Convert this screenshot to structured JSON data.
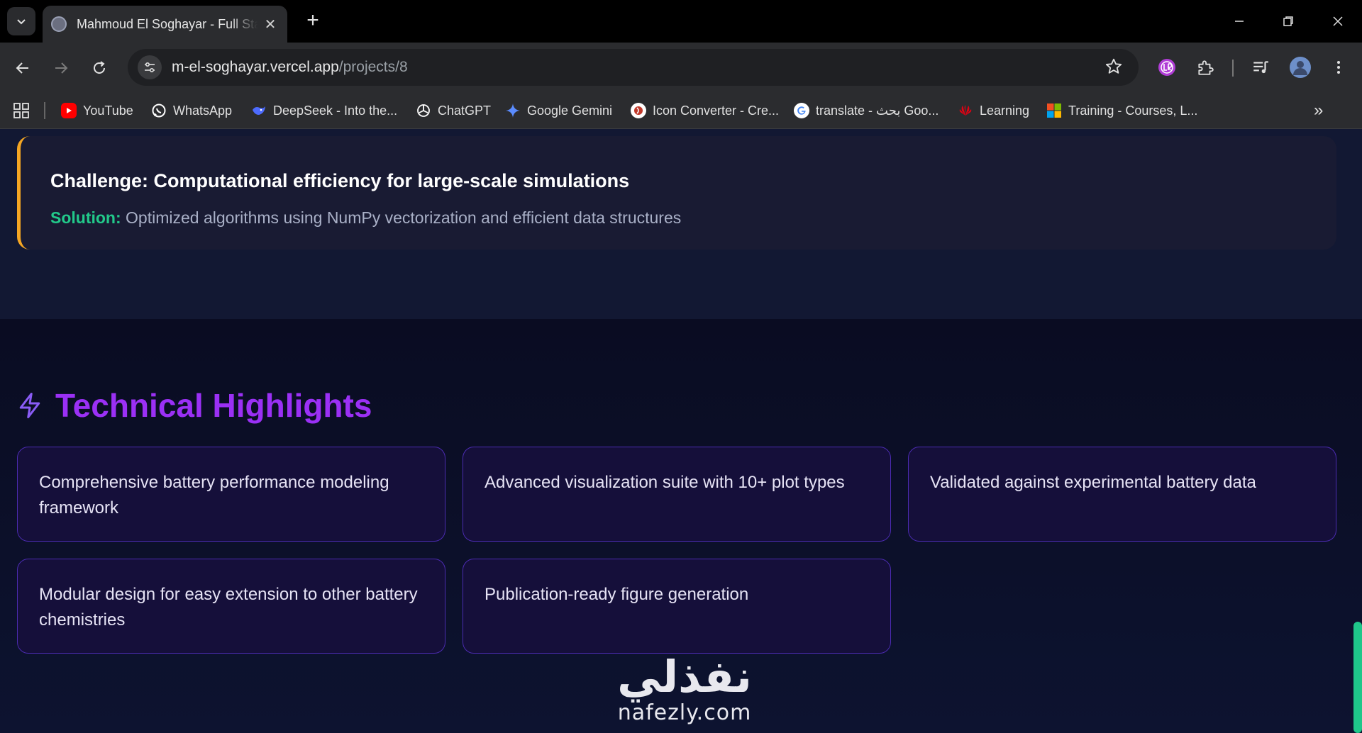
{
  "browser": {
    "tab_title": "Mahmoud El Soghayar - Full Stack Developer",
    "tab_close": "✕",
    "new_tab": "+",
    "url_domain": "m-el-soghayar.vercel.app",
    "url_path": "/projects/8",
    "bookmarks_more": "»",
    "bookmarks": [
      {
        "label": "YouTube",
        "icon": "youtube-icon",
        "color": "#ff0000"
      },
      {
        "label": "WhatsApp",
        "icon": "whatsapp-icon",
        "color": "#ffffff"
      },
      {
        "label": "DeepSeek - Into the...",
        "icon": "deepseek-icon",
        "color": "#4d6bfe"
      },
      {
        "label": "ChatGPT",
        "icon": "chatgpt-icon",
        "color": "#ffffff"
      },
      {
        "label": "Google Gemini",
        "icon": "gemini-icon",
        "color": "#5b8cff"
      },
      {
        "label": "Icon Converter - Cre...",
        "icon": "icon-converter-icon",
        "color": "#c0392b"
      },
      {
        "label": "translate - بحث Goo...",
        "icon": "google-icon",
        "color": "#ffffff"
      },
      {
        "label": "Learning",
        "icon": "huawei-icon",
        "color": "#e60012"
      },
      {
        "label": "Training - Courses, L...",
        "icon": "microsoft-icon",
        "color": "#f25022"
      }
    ]
  },
  "challenge": {
    "title": "Challenge: Computational efficiency for large-scale simulations",
    "solution_label": "Solution:",
    "solution_text": "Optimized algorithms using NumPy vectorization and efficient data structures",
    "accent_color": "#f5a623"
  },
  "highlights": {
    "heading": "Technical Highlights",
    "accent_color": "#9b30f5",
    "items": [
      "Comprehensive battery performance modeling framework",
      "Advanced visualization suite with 10+ plot types",
      "Validated against experimental battery data",
      "Modular design for easy extension to other battery chemistries",
      "Publication-ready figure generation"
    ]
  },
  "watermark": {
    "arabic": "نفذلي",
    "latin": "nafezly.com"
  }
}
